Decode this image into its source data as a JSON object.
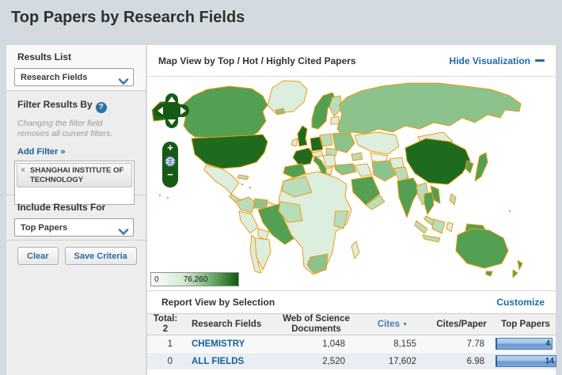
{
  "page": {
    "title": "Top Papers by Research Fields"
  },
  "icons": {
    "help_icon": "?",
    "remove_icon": "×",
    "zoom_in_icon": "+",
    "zoom_out_icon": "−",
    "sort_desc_icon": "▼"
  },
  "colors": {
    "page_background": "#d3dbe1",
    "link_blue": "#1c6ca8",
    "map_border_orange": "#ef9b14",
    "map_dark_green": "#1e6b1e",
    "map_medium_green": "#53a053",
    "bar_blue": "#6b9ad4"
  },
  "sidebar": {
    "results_list": {
      "label": "Results List",
      "selected": "Research Fields"
    },
    "filter": {
      "label": "Filter Results By",
      "note": "Changing the filter field removes all current filters.",
      "add_filter": "Add Filter »",
      "tags": [
        {
          "label": "SHANGHAI INSTITUTE OF TECHNOLOGY"
        }
      ]
    },
    "include_results": {
      "label": "Include Results For",
      "selected": "Top Papers"
    },
    "buttons": {
      "clear": "Clear",
      "save": "Save Criteria"
    }
  },
  "map_section": {
    "title": "Map View by Top / Hot / Highly Cited Papers",
    "hide_link": "Hide Visualization",
    "legend": {
      "min": "0",
      "max": "76,260"
    }
  },
  "report": {
    "title": "Report View by Selection",
    "customize": "Customize",
    "table": {
      "total_label": "Total:",
      "total_value": "2",
      "columns": [
        "Research Fields",
        "Web of Science Documents",
        "Cites",
        "Cites/Paper",
        "Top Papers"
      ],
      "rows": [
        {
          "count": "1",
          "field": "CHEMISTRY",
          "docs": "1,048",
          "cites": "8,155",
          "cites_per_paper": "7.78",
          "top_papers": "4"
        },
        {
          "count": "0",
          "field": "ALL FIELDS",
          "docs": "2,520",
          "cites": "17,602",
          "cites_per_paper": "6.98",
          "top_papers": "14"
        }
      ]
    }
  }
}
